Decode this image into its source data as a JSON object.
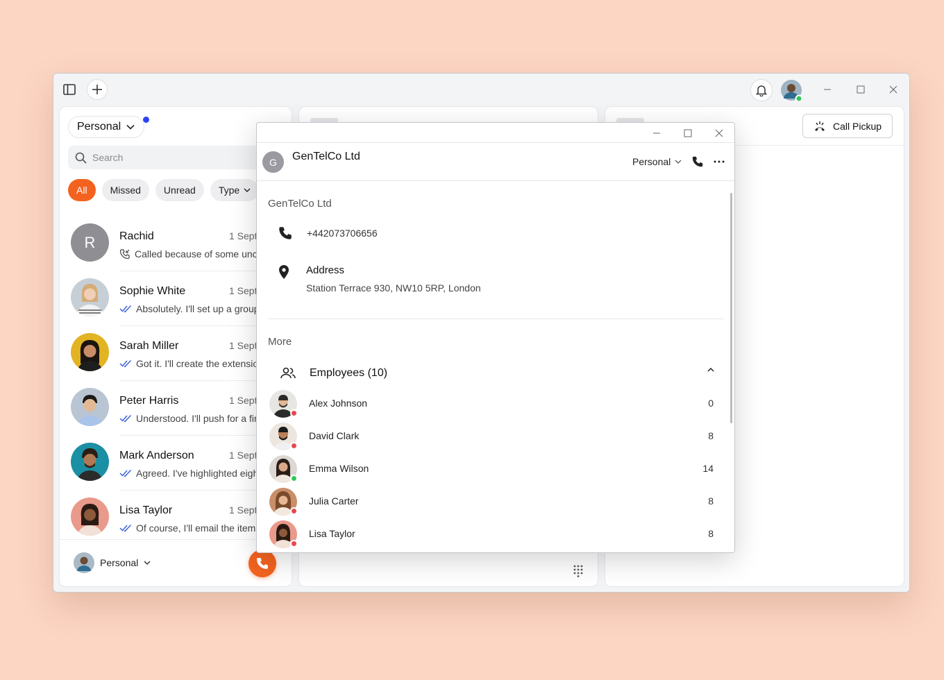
{
  "sidebar_header": {
    "account_label": "Personal"
  },
  "search": {
    "placeholder": "Search"
  },
  "filters": [
    {
      "label": "All",
      "active": true
    },
    {
      "label": "Missed",
      "active": false
    },
    {
      "label": "Unread",
      "active": false
    },
    {
      "label": "Type",
      "active": false
    }
  ],
  "conversations": [
    {
      "initial": "R",
      "name": "Rachid",
      "date": "1 Septe",
      "preview": "Called because of some unc",
      "status_icon": "phone-incoming-icon",
      "avatar_color": "#8e8e93"
    },
    {
      "name": "Sophie White",
      "date": "1 Septe",
      "preview": "Absolutely. I'll set up a group",
      "status_icon": "double-check-icon",
      "avatar_color": "#d9b69a"
    },
    {
      "name": "Sarah Miller",
      "date": "1 Septe",
      "preview": "Got it. I'll create the extensio",
      "status_icon": "double-check-icon",
      "avatar_color": "#e2b423"
    },
    {
      "name": "Peter Harris",
      "date": "1 Septe",
      "preview": "Understood. I'll push for a fir",
      "status_icon": "double-check-icon",
      "avatar_color": "#b9c5d3"
    },
    {
      "name": "Mark Anderson",
      "date": "1 Septe",
      "preview": "Agreed. I've highlighted eigh",
      "status_icon": "double-check-icon",
      "avatar_color": "#1b8fa3"
    },
    {
      "name": "Lisa Taylor",
      "date": "1 Septe",
      "preview": "Of course, I'll email the itemi",
      "status_icon": "double-check-icon",
      "avatar_color": "#e99a8a"
    }
  ],
  "footer": {
    "account_label": "Personal"
  },
  "right_panel": {
    "call_pickup_label": "Call Pickup"
  },
  "contact_window": {
    "avatar_initial": "G",
    "title": "GenTelCo Ltd",
    "account_label": "Personal",
    "section_title": "GenTelCo Ltd",
    "phone": "+442073706656",
    "address_label": "Address",
    "address_value": "Station Terrace 930, NW10 5RP, London",
    "more_title": "More",
    "employees_label": "Employees (10)",
    "employees": [
      {
        "name": "Alex Johnson",
        "count": "0",
        "status": "busy",
        "avatar_color": "#c9c2b8"
      },
      {
        "name": "David Clark",
        "count": "8",
        "status": "busy",
        "avatar_color": "#d8cfc4"
      },
      {
        "name": "Emma Wilson",
        "count": "14",
        "status": "online",
        "avatar_color": "#d6d1cc"
      },
      {
        "name": "Julia Carter",
        "count": "8",
        "status": "busy",
        "avatar_color": "#c98f6a"
      },
      {
        "name": "Lisa Taylor",
        "count": "8",
        "status": "busy",
        "avatar_color": "#e99a8a"
      }
    ]
  },
  "colors": {
    "accent": "#f3631f",
    "online": "#34c759",
    "busy": "#e5484d",
    "notification_dot": "#2c43f5"
  }
}
